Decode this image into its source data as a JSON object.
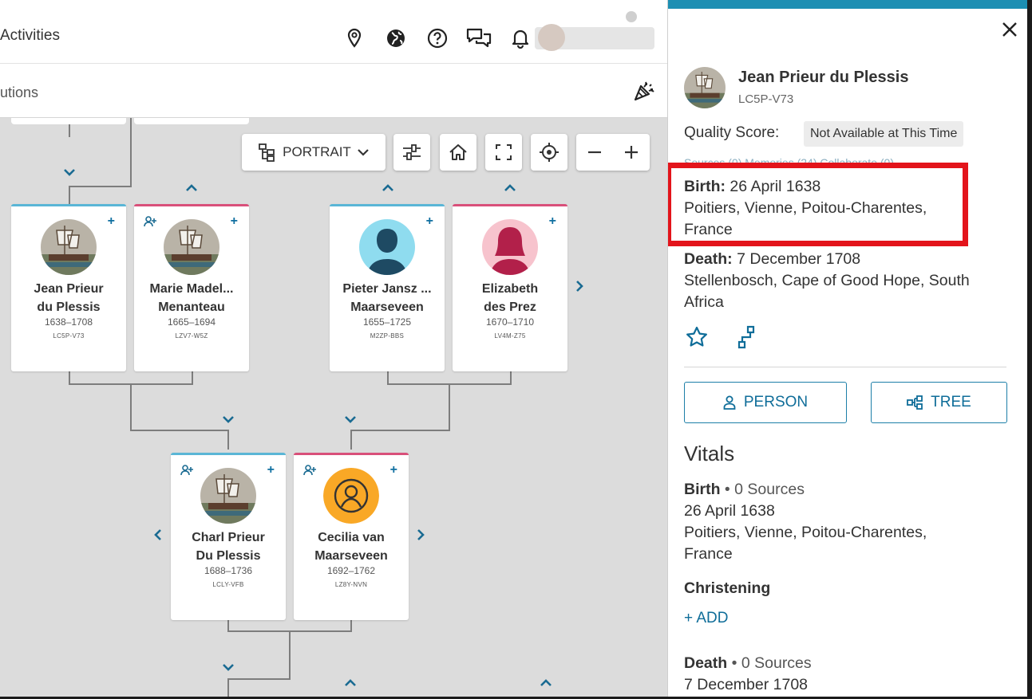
{
  "header": {
    "nav_title": "Activities",
    "sub_title": "utions",
    "icons": [
      "location-pin-icon",
      "globe-icon",
      "help-icon",
      "messages-icon",
      "bell-icon"
    ]
  },
  "toolbar": {
    "view_label": "PORTRAIT",
    "icons": [
      "tree-layout-icon",
      "chevron-down-icon",
      "filter-sliders-icon",
      "home-icon",
      "fullscreen-icon",
      "locate-icon",
      "zoom-out-icon",
      "zoom-in-icon"
    ]
  },
  "cards": [
    {
      "name1": "Jean Prieur",
      "name2": "du Plessis",
      "years": "1638–1708",
      "pid": "LC5P-V73"
    },
    {
      "name1": "Marie Madel...",
      "name2": "Menanteau",
      "years": "1665–1694",
      "pid": "LZV7-W5Z"
    },
    {
      "name1": "Pieter Jansz ...",
      "name2": "Maarseveen",
      "years": "1655–1725",
      "pid": "M2ZP-BBS"
    },
    {
      "name1": "Elizabeth",
      "name2": "des Prez",
      "years": "1670–1710",
      "pid": "LV4M-Z75"
    },
    {
      "name1": "Charl Prieur",
      "name2": "Du Plessis",
      "years": "1688–1736",
      "pid": "LCLY-VFB"
    },
    {
      "name1": "Cecilia van",
      "name2": "Maarseveen",
      "years": "1692–1762",
      "pid": "LZ8Y-NVN"
    }
  ],
  "panel": {
    "name": "Jean Prieur du Plessis",
    "pid": "LC5P-V73",
    "quality_label": "Quality Score:",
    "quality_value": "Not Available at This Time",
    "faded_tabs": "Sources (0)       Memories (24)       Collaborate (0)",
    "birth_label": "Birth:",
    "birth_date": "26 April 1638",
    "birth_place_1": "Poitiers, Vienne, Poitou-Charentes,",
    "birth_place_2": "France",
    "death_label": "Death:",
    "death_date": "7 December 1708",
    "death_place_1": "Stellenbosch, Cape of Good Hope, South",
    "death_place_2": "Africa",
    "person_btn": "PERSON",
    "tree_btn": "TREE",
    "vitals": "Vitals",
    "v_birth_label": "Birth",
    "v_birth_sources": "• 0 Sources",
    "v_birth_date": "26 April 1638",
    "v_birth_place_1": "Poitiers, Vienne, Poitou-Charentes,",
    "v_birth_place_2": "France",
    "christening": "Christening",
    "add": "+  ADD",
    "v_death_label": "Death",
    "v_death_sources": "• 0 Sources",
    "v_death_date": "7 December 1708"
  },
  "colors": {
    "accent": "#1d8fb3",
    "male": "#5ab6d6",
    "female": "#d9507a",
    "highlight": "#e3141b",
    "link": "#0f6d99"
  }
}
